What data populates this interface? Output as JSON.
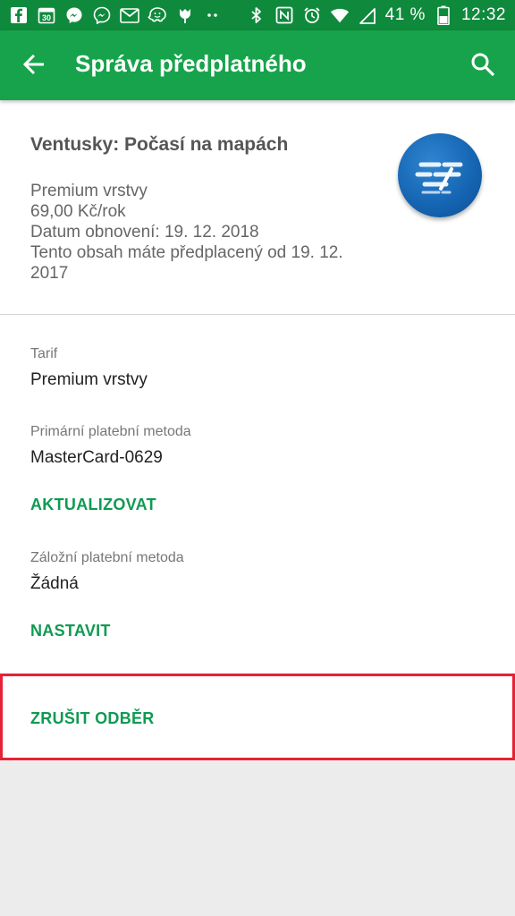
{
  "status_bar": {
    "battery": "41 %",
    "time": "12:32",
    "icons_left": [
      "facebook-icon",
      "calendar-icon",
      "messenger-icon",
      "messenger-icon",
      "gmail-icon",
      "waze-icon",
      "tulip-icon",
      "more-dots-icon"
    ],
    "icons_right": [
      "bluetooth-icon",
      "nfc-icon",
      "alarm-icon",
      "wifi-icon",
      "signal-icon"
    ],
    "calendar_day": "30"
  },
  "app_bar": {
    "title": "Správa předplatného",
    "back_icon": "arrow-back-icon",
    "search_icon": "search-icon"
  },
  "subscription": {
    "app_name": "Ventusky: Počasí na mapách",
    "plan": "Premium vrstvy",
    "price": "69,00 Kč/rok",
    "renewal": "Datum obnovení: 19. 12. 2018",
    "subscribed_since_line1": "Tento obsah máte předplacený od 19. 12.",
    "subscribed_since_line2": "2017"
  },
  "details": {
    "tariff_label": "Tarif",
    "tariff_value": "Premium vrstvy",
    "primary_label": "Primární platební metoda",
    "primary_value": "MasterCard-0629",
    "update_action": "AKTUALIZOVAT",
    "backup_label": "Záložní platební metoda",
    "backup_value": "Žádná",
    "set_action": "NASTAVIT",
    "cancel_action": "ZRUŠIT ODBĚR"
  },
  "colors": {
    "status_bar": "#0f8a3c",
    "app_bar": "#17a34b",
    "accent_text": "#0f9a52",
    "highlight_border": "#e52236"
  }
}
